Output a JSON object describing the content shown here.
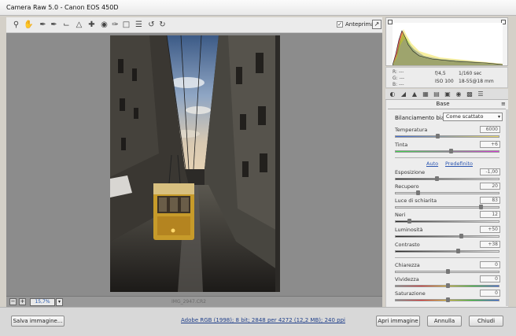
{
  "window": {
    "title": "Camera Raw 5.0  -  Canon EOS 450D"
  },
  "toolbar": {
    "tools": [
      "zoom-tool-icon",
      "hand-tool-icon",
      "white-balance-tool-icon",
      "color-sampler-tool-icon",
      "crop-tool-icon",
      "straighten-tool-icon",
      "spot-removal-tool-icon",
      "red-eye-tool-icon",
      "adjustment-brush-icon",
      "graduated-filter-icon",
      "preferences-icon",
      "rotate-left-icon",
      "rotate-right-icon"
    ],
    "preview_label": "Anteprima",
    "preview_checked": true
  },
  "status": {
    "zoom": "15,7%",
    "filename": "IMG_2947.CR2"
  },
  "readout": {
    "r_label": "R:",
    "r_value": "---",
    "g_label": "G:",
    "g_value": "---",
    "b_label": "B:",
    "b_value": "---",
    "aperture": "f/4,5",
    "shutter": "1/160 sec",
    "iso": "ISO 100",
    "lens": "18-55@18 mm"
  },
  "panel": {
    "title": "Base",
    "wb_label": "Bilanciamento bianco:",
    "wb_value": "Come scattato",
    "auto_label": "Auto",
    "default_label": "Predefinito",
    "sliders": {
      "temperatura": {
        "label": "Temperatura",
        "value": "6000",
        "level": 0.4
      },
      "tinta": {
        "label": "Tinta",
        "value": "+6",
        "level": 0.53
      },
      "esposizione": {
        "label": "Esposizione",
        "value": "-1,00",
        "level": 0.39
      },
      "recupero": {
        "label": "Recupero",
        "value": "20",
        "level": 0.2
      },
      "luce": {
        "label": "Luce di schiarita",
        "value": "83",
        "level": 0.83
      },
      "neri": {
        "label": "Neri",
        "value": "12",
        "level": 0.12
      },
      "luminosita": {
        "label": "Luminosità",
        "value": "+50",
        "level": 0.63
      },
      "contrasto": {
        "label": "Contrasto",
        "value": "+38",
        "level": 0.6
      },
      "chiarezza": {
        "label": "Chiarezza",
        "value": "0",
        "level": 0.5
      },
      "vividezza": {
        "label": "Vividezza",
        "value": "0",
        "level": 0.5
      },
      "saturazione": {
        "label": "Saturazione",
        "value": "0",
        "level": 0.5
      }
    }
  },
  "bottom": {
    "save_label": "Salva immagine...",
    "workflow": "Adobe RGB (1998); 8 bit; 2848 per 4272 (12,2 MB); 240 ppi",
    "open_label": "Apri immagine",
    "cancel_label": "Annulla",
    "close_label": "Chiudi"
  },
  "colors": {
    "accent_link": "#2b55b0",
    "canvas": "#8c8c8c"
  }
}
